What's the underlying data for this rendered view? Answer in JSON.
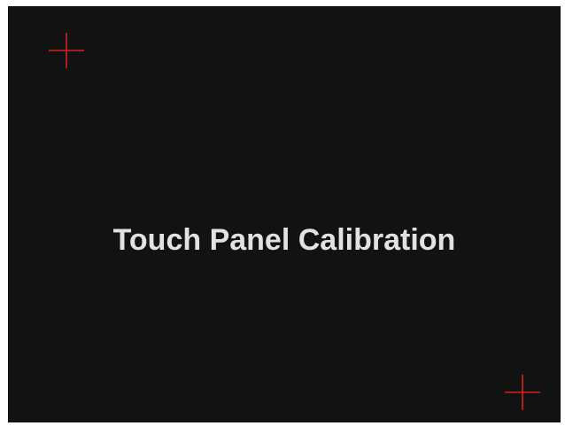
{
  "screen": {
    "title": "Touch Panel Calibration"
  },
  "targets": [
    {
      "name": "top-left",
      "icon": "crosshair-icon"
    },
    {
      "name": "bottom-right",
      "icon": "crosshair-icon"
    }
  ],
  "colors": {
    "background": "#121212",
    "text": "#e2e2e2",
    "crosshair": "#d42121"
  }
}
